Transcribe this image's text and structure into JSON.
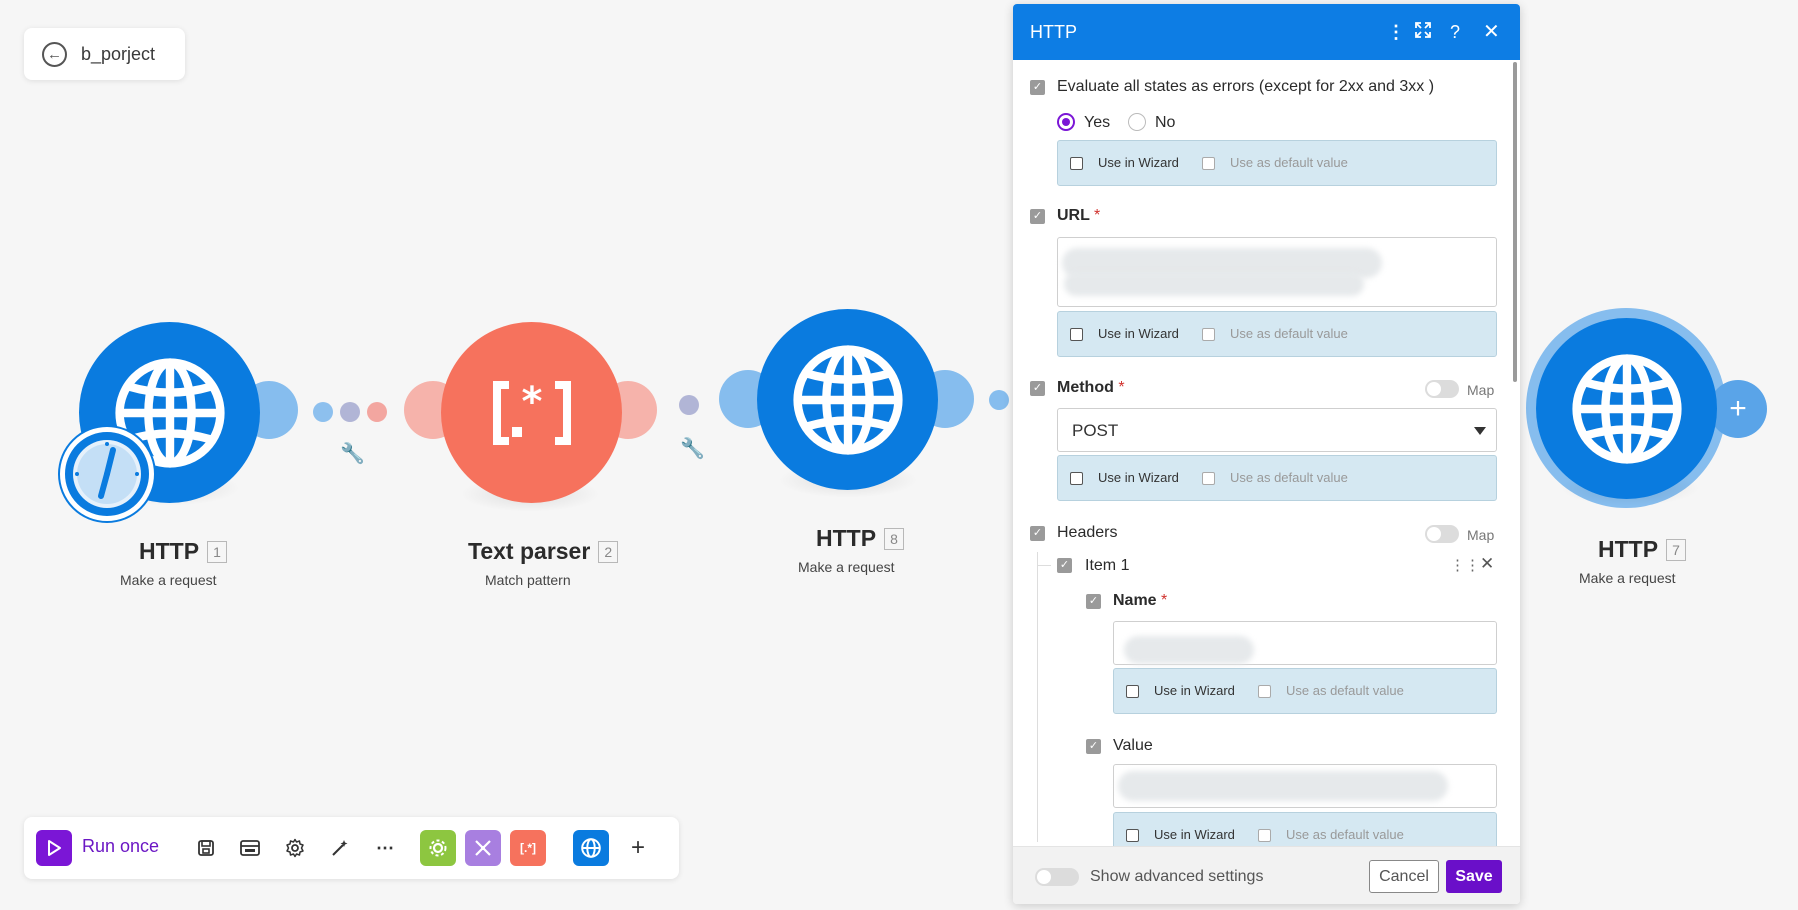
{
  "project": {
    "name": "b_porject"
  },
  "modules": [
    {
      "title": "HTTP",
      "number": "1",
      "subtitle": "Make a request"
    },
    {
      "title": "Text parser",
      "number": "2",
      "subtitle": "Match pattern"
    },
    {
      "title": "HTTP",
      "number": "8",
      "subtitle": "Make a request"
    },
    {
      "title": "HTTP",
      "number": "7",
      "subtitle": "Make a request"
    }
  ],
  "toolbar": {
    "run_label": "Run once",
    "colors": {
      "run": "#7b16d6",
      "tools": "#8dc640",
      "flow": "#a87fe0",
      "parser": "#f6725d",
      "http": "#0a7bdf"
    }
  },
  "panel": {
    "title": "HTTP",
    "evaluate_label": "Evaluate all states as errors (except for 2xx and 3xx )",
    "yes_label": "Yes",
    "no_label": "No",
    "url_label": "URL",
    "method_label": "Method",
    "method_value": "POST",
    "headers_label": "Headers",
    "map_label": "Map",
    "item_label": "Item 1",
    "name_label": "Name",
    "value_label": "Value",
    "use_in_wizard": "Use in Wizard",
    "use_as_default": "Use as default value",
    "required_mark": "*",
    "show_advanced": "Show advanced settings",
    "cancel": "Cancel",
    "save": "Save"
  },
  "colors": {
    "accent": "#0d7de4",
    "save": "#6a0fc9",
    "wizard_bg": "#d5e8f2"
  }
}
